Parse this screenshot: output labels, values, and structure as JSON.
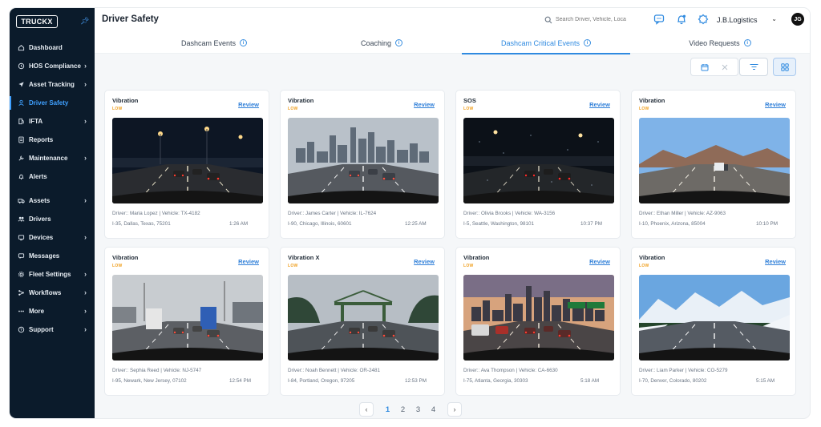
{
  "app": {
    "logo": "TRUCKX"
  },
  "sidebar": {
    "items": [
      {
        "label": "Dashboard",
        "icon": "home-icon",
        "chevron": false,
        "active": false
      },
      {
        "label": "HOS Compliance",
        "icon": "clock-icon",
        "chevron": true,
        "active": false
      },
      {
        "label": "Asset Tracking",
        "icon": "navigation-icon",
        "chevron": true,
        "active": false
      },
      {
        "label": "Driver Safety",
        "icon": "shield-user-icon",
        "chevron": false,
        "active": true
      },
      {
        "label": "IFTA",
        "icon": "fuel-icon",
        "chevron": true,
        "active": false
      },
      {
        "label": "Reports",
        "icon": "report-icon",
        "chevron": false,
        "active": false
      },
      {
        "label": "Maintenance",
        "icon": "wrench-icon",
        "chevron": true,
        "active": false
      },
      {
        "label": "Alerts",
        "icon": "alert-icon",
        "chevron": false,
        "active": false
      },
      {
        "label": "Assets",
        "icon": "truck-icon",
        "chevron": true,
        "active": false
      },
      {
        "label": "Drivers",
        "icon": "users-icon",
        "chevron": false,
        "active": false
      },
      {
        "label": "Devices",
        "icon": "device-icon",
        "chevron": true,
        "active": false
      },
      {
        "label": "Messages",
        "icon": "message-icon",
        "chevron": false,
        "active": false
      },
      {
        "label": "Fleet Settings",
        "icon": "gear-icon",
        "chevron": true,
        "active": false
      },
      {
        "label": "Workflows",
        "icon": "workflow-icon",
        "chevron": true,
        "active": false
      },
      {
        "label": "More",
        "icon": "more-icon",
        "chevron": true,
        "active": false
      },
      {
        "label": "Support",
        "icon": "support-icon",
        "chevron": true,
        "active": false
      }
    ]
  },
  "header": {
    "title": "Driver Safety",
    "search_placeholder": "Search Driver, Vehicle, Loca",
    "org": "J.B.Logistics",
    "avatar": "JG"
  },
  "tabs": [
    {
      "label": "Dashcam Events",
      "active": false
    },
    {
      "label": "Coaching",
      "active": false
    },
    {
      "label": "Dashcam Critical Events",
      "active": true
    },
    {
      "label": "Video Requests",
      "active": false
    }
  ],
  "cards": [
    {
      "type": "Vibration",
      "severity": "LOW",
      "review": "Review",
      "driver": "Driver:: Maria Lopez | Vehicle: TX-4182",
      "location": "I-35, Dallas, Texas, 75201",
      "time": "1:26 AM",
      "scene": "night"
    },
    {
      "type": "Vibration",
      "severity": "LOW",
      "review": "Review",
      "driver": "Driver:: James Carter | Vehicle: IL-7624",
      "location": "I-90, Chicago, Illinois, 60601",
      "time": "12:25 AM",
      "scene": "city"
    },
    {
      "type": "SOS",
      "severity": "LOW",
      "review": "Review",
      "driver": "Driver:: Olivia Brooks | Vehicle: WA-3156",
      "location": "I-5, Seattle, Washington, 98101",
      "time": "10:37 PM",
      "scene": "rainnight"
    },
    {
      "type": "Vibration",
      "severity": "LOW",
      "review": "Review",
      "driver": "Driver:: Ethan Miller | Vehicle: AZ-9063",
      "location": "I-10, Phoenix, Arizona, 85004",
      "time": "10:10 PM",
      "scene": "desert"
    },
    {
      "type": "Vibration",
      "severity": "LOW",
      "review": "Review",
      "driver": "Driver:: Sephia Reed | Vehicle: NJ-5747",
      "location": "I-95, Newark, New Jersey, 07102",
      "time": "12:54 PM",
      "scene": "industrial"
    },
    {
      "type": "Vibration X",
      "severity": "LOW",
      "review": "Review",
      "driver": "Driver:: Noah Bennett | Vehicle: OR-2481",
      "location": "I-84, Portland, Oregon, 97205",
      "time": "12:53 PM",
      "scene": "bridge"
    },
    {
      "type": "Vibration",
      "severity": "LOW",
      "review": "Review",
      "driver": "Driver:: Ava Thompson | Vehicle: CA-6630",
      "location": "I-75, Atlanta, Georgia, 30303",
      "time": "5:18 AM",
      "scene": "dusk"
    },
    {
      "type": "Vibration",
      "severity": "LOW",
      "review": "Review",
      "driver": "Driver:: Liam Parker | Vehicle: CO-5279",
      "location": "I-70, Denver, Colorado, 80202",
      "time": "5:15 AM",
      "scene": "snow"
    }
  ],
  "pagination": {
    "pages": [
      "1",
      "2",
      "3",
      "4"
    ],
    "current": "1"
  },
  "colors": {
    "sidebar_bg": "#0b1b2b",
    "accent": "#2f8ae0",
    "severity_low": "#f0a020"
  }
}
